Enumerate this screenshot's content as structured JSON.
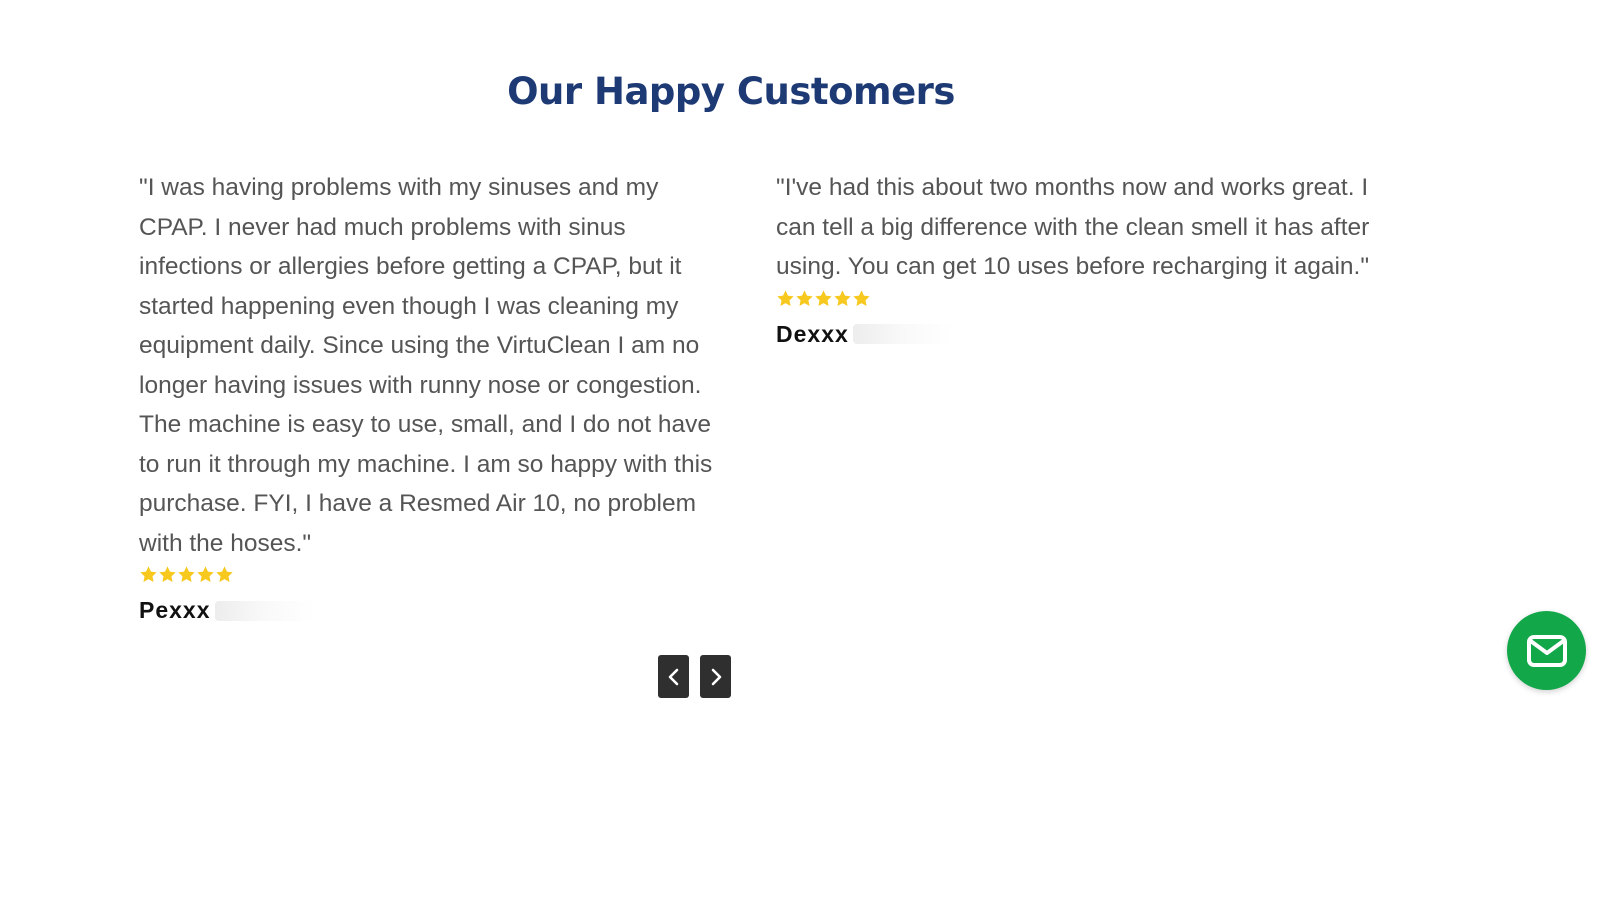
{
  "section": {
    "title": "Our Happy Customers"
  },
  "reviews": [
    {
      "text": "\"I was having problems with my sinuses and my CPAP. I never had much problems with sinus infections or allergies before getting a CPAP, but it started happening even though I was cleaning my equipment daily. Since using the VirtuClean I am no longer having issues with runny nose or congestion. The machine is easy to use, small, and I do not have to run it through my machine. I am so happy with this purchase. FYI, I have a Resmed Air 10, no problem with the hoses.\"",
      "rating": 5,
      "author": "Pexxx"
    },
    {
      "text": "\"I've had this about two months now and works great. I can tell a big difference with the clean smell it has after using. You can get 10 uses before recharging it again.\"",
      "rating": 5,
      "author": "Dexxx"
    }
  ],
  "carousel": {
    "prev_icon": "chevron-left-icon",
    "next_icon": "chevron-right-icon"
  },
  "contact": {
    "icon": "mail-icon"
  },
  "colors": {
    "title": "#1e3a74",
    "review_text": "#555555",
    "star": "#f7c81e",
    "nav_button": "#2f2f2f",
    "mail_button": "#12a84a"
  }
}
